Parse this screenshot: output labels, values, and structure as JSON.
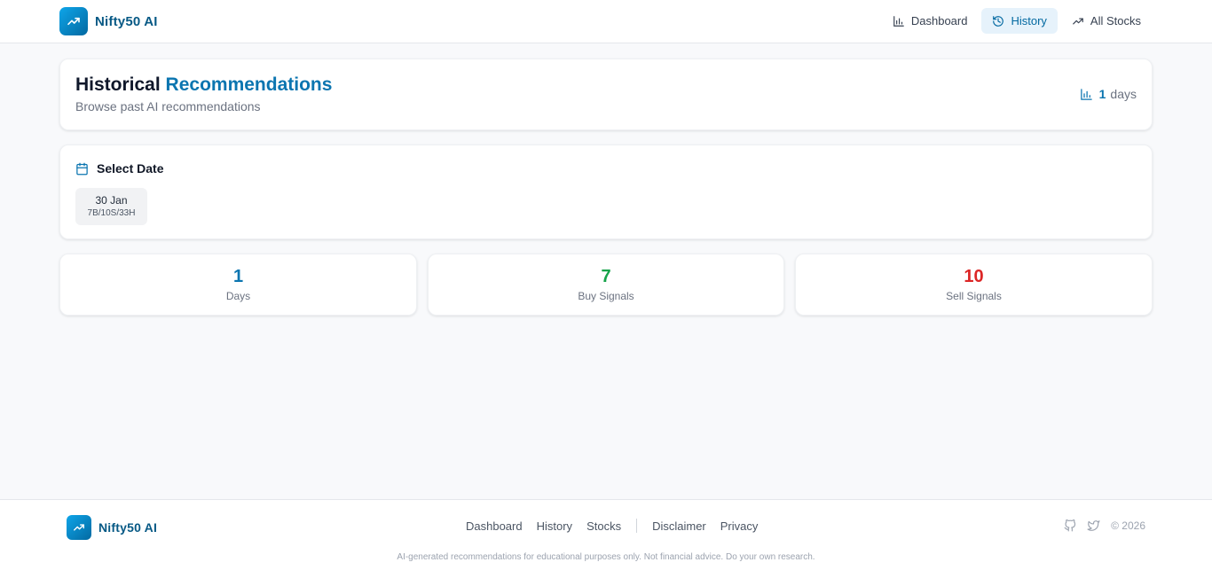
{
  "header": {
    "brand": "Nifty50 AI",
    "nav": [
      {
        "label": "Dashboard",
        "icon": "bar-chart-icon"
      },
      {
        "label": "History",
        "icon": "history-icon",
        "active": true
      },
      {
        "label": "All Stocks",
        "icon": "trending-up-icon"
      }
    ]
  },
  "hero": {
    "title": "Historical",
    "title_accent": "Recommendations",
    "subtitle": "Browse past AI recommendations",
    "days_count": "1",
    "days_label": "days"
  },
  "date_picker": {
    "heading": "Select Date",
    "dates": [
      {
        "date": "30 Jan",
        "meta": "7B/10S/33H"
      }
    ]
  },
  "stats": [
    {
      "value": "1",
      "label": "Days",
      "color": "#0b75b0"
    },
    {
      "value": "7",
      "label": "Buy Signals",
      "color": "#16a34a"
    },
    {
      "value": "10",
      "label": "Sell Signals",
      "color": "#dc2626"
    }
  ],
  "footer": {
    "brand": "Nifty50 AI",
    "links": [
      "Dashboard",
      "History",
      "Stocks",
      "Disclaimer",
      "Privacy"
    ],
    "copyright": "© 2026",
    "disclaimer": "AI-generated recommendations for educational purposes only. Not financial advice. Do your own research."
  },
  "colors": {
    "accent": "#0b75b0",
    "buy": "#16a34a",
    "sell": "#dc2626"
  }
}
